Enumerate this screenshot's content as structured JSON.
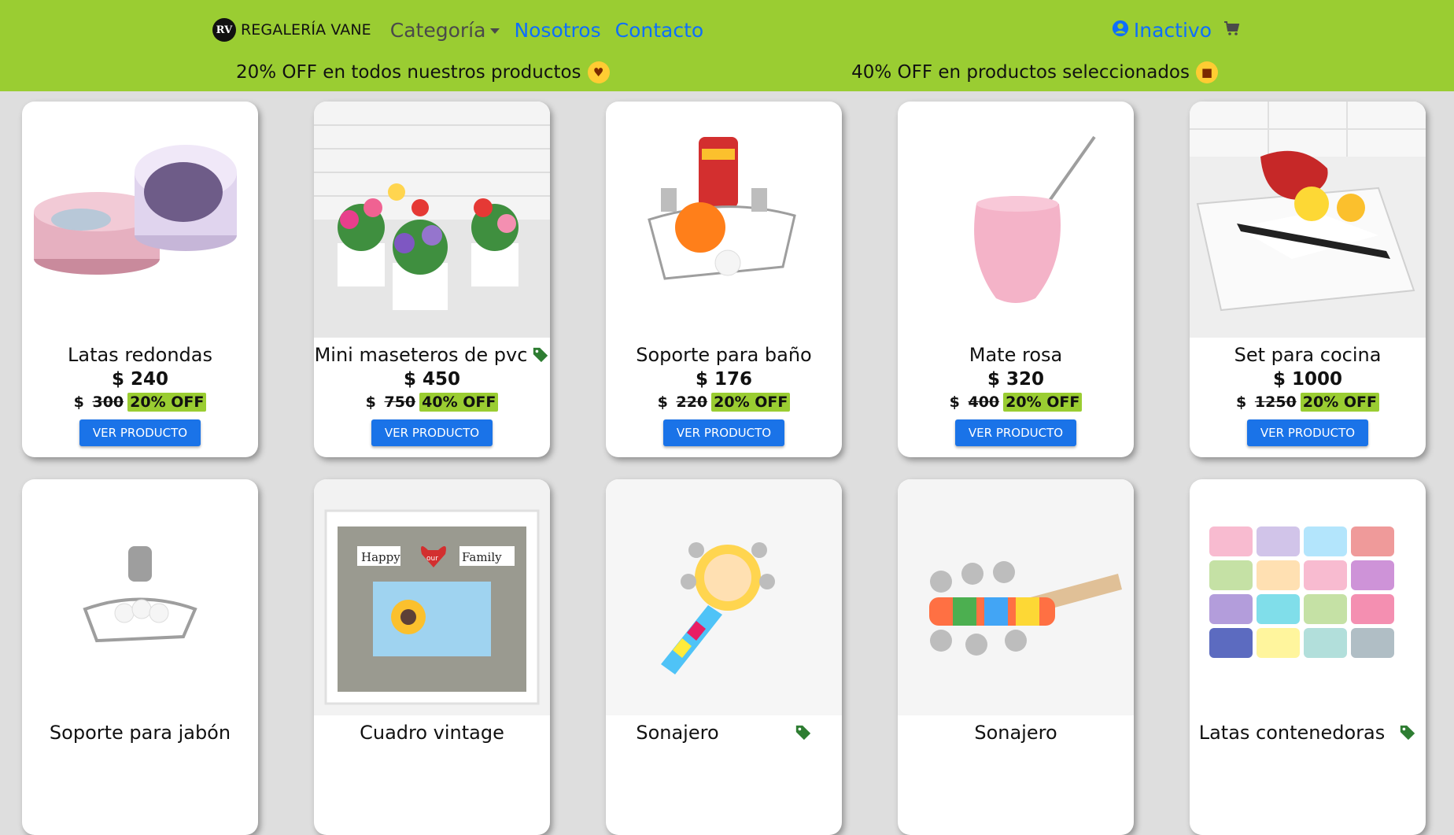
{
  "header": {
    "brand_logo_text": "RV",
    "brand": "REGALERÍA VANE",
    "nav": {
      "category": "Categoría",
      "about": "Nosotros",
      "contact": "Contacto"
    },
    "user_status": "Inactivo",
    "promos": {
      "left": "20% OFF en todos nuestros productos",
      "right": "40% OFF en productos seleccionados"
    }
  },
  "colors": {
    "topbar": "#9acd32",
    "link": "#0d6efd",
    "button": "#1a73e8",
    "badge": "#9acd32",
    "tag_icon": "#2e7d32",
    "page_bg": "#dedede"
  },
  "products": [
    {
      "name": "Latas redondas",
      "price": "$ 240",
      "old_currency": "$",
      "old_value": "300",
      "discount": "20% OFF",
      "button": "VER PRODUCTO",
      "tag": false
    },
    {
      "name": "Mini maseteros de pvc",
      "price": "$ 450",
      "old_currency": "$",
      "old_value": "750",
      "discount": "40% OFF",
      "button": "VER PRODUCTO",
      "tag": true
    },
    {
      "name": "Soporte para baño",
      "price": "$ 176",
      "old_currency": "$",
      "old_value": "220",
      "discount": "20% OFF",
      "button": "VER PRODUCTO",
      "tag": false
    },
    {
      "name": "Mate rosa",
      "price": "$ 320",
      "old_currency": "$",
      "old_value": "400",
      "discount": "20% OFF",
      "button": "VER PRODUCTO",
      "tag": false
    },
    {
      "name": "Set para cocina",
      "price": "$ 1000",
      "old_currency": "$",
      "old_value": "1250",
      "discount": "20% OFF",
      "button": "VER PRODUCTO",
      "tag": false
    },
    {
      "name": "Soporte para jabón",
      "tag": false
    },
    {
      "name": "Cuadro vintage",
      "tag": false
    },
    {
      "name": "Sonajero",
      "tag": true
    },
    {
      "name": "Sonajero",
      "tag": false
    },
    {
      "name": "Latas contenedoras",
      "tag": true
    }
  ],
  "frame_labels": {
    "left": "Happy",
    "mid": "our",
    "right": "Family"
  }
}
